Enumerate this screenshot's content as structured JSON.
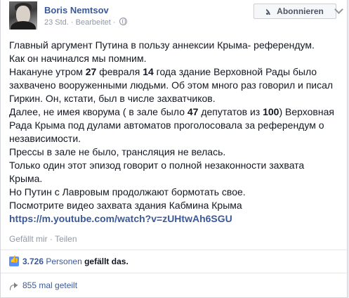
{
  "post": {
    "author": "Boris Nemtsov",
    "time": "23 Std.",
    "separator": "·",
    "edited": "Bearbeitet",
    "subscribe_label": "Abonnieren",
    "lines": [
      [
        "Главный аргумент Путина в пользу аннексии Крыма- референдум."
      ],
      [
        "Как он начинался мы помним."
      ],
      [
        "Накануне утром ",
        {
          "b": "27"
        },
        " февраля ",
        {
          "b": "14"
        },
        " года здание Верховной Рады было"
      ],
      [
        "захвачено вооруженными людьми. Об этом много раз говорил и писал"
      ],
      [
        "Гиркин. Он, кстати, был в числе захватчиков."
      ],
      [
        "Далее, не имея кворума ( в зале было ",
        {
          "b": "47"
        },
        " депутатов из ",
        {
          "b": "100"
        },
        ") Верховная"
      ],
      [
        "Рада Крыма под дулами автоматов проголосовала за референдум о"
      ],
      [
        "независимости."
      ],
      [
        "Прессы в зале не было, трансляция не велась."
      ],
      [
        "Только один этот эпизод говорит о полной незаконности захвата"
      ],
      [
        "Крыма."
      ],
      [
        "Но Путин с Лавровым продолжают бормотать свое."
      ],
      [
        "Посмотрите видео захвата здания Кабмина Крыма"
      ]
    ],
    "link": "https://m.youtube.com/watch?v=zUHtwAh6SGU"
  },
  "actions": {
    "like": "Gefällt mir",
    "separator": "·",
    "share": "Teilen"
  },
  "likes": {
    "count": "3.726",
    "personen": "Personen",
    "suffix": "gefällt das."
  },
  "shares": {
    "label": "855 mal geteilt"
  },
  "colors": {
    "link": "#3b5998",
    "meta": "#9197a3",
    "text": "#141823"
  }
}
